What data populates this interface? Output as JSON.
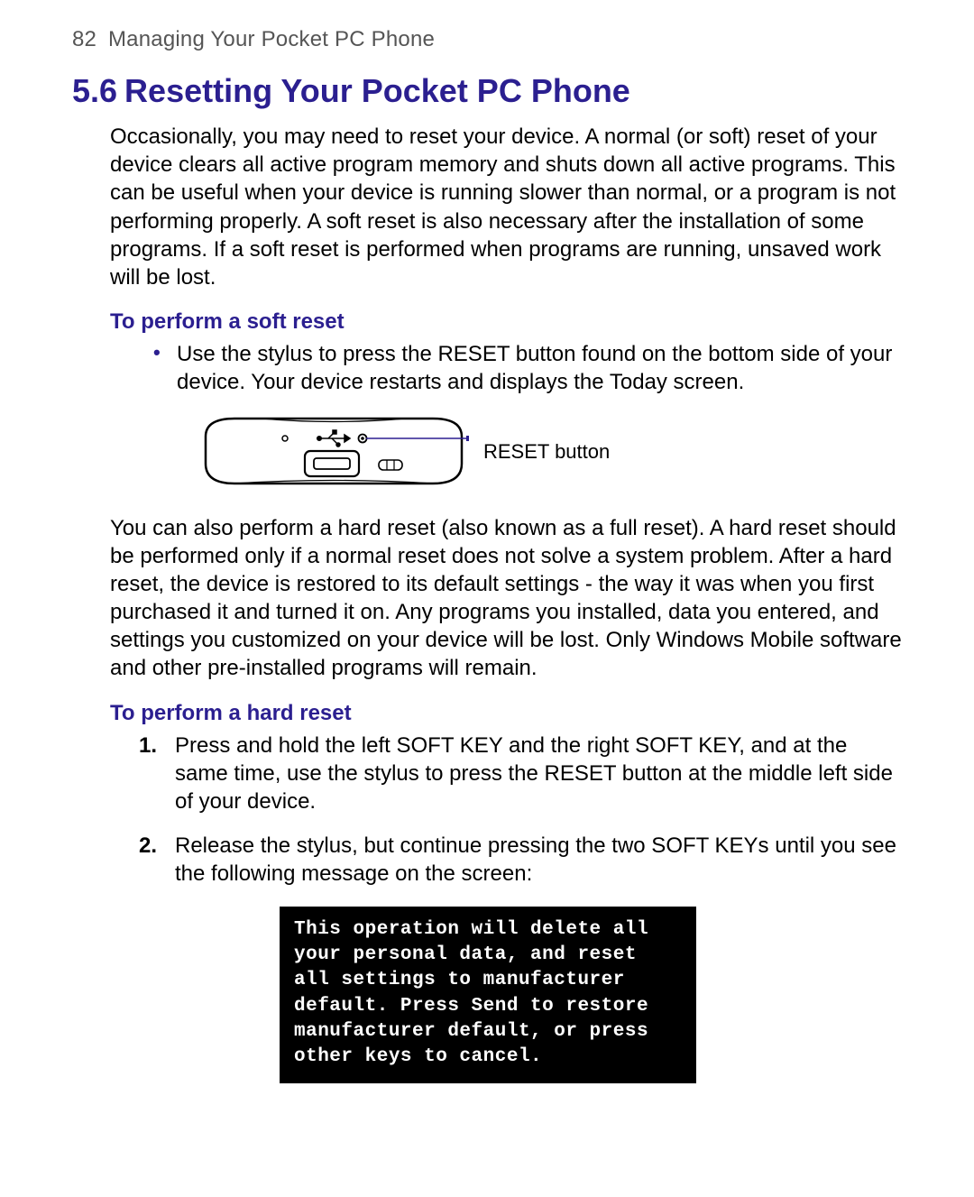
{
  "header": {
    "page_number": "82",
    "chapter_title": "Managing Your Pocket PC Phone"
  },
  "section": {
    "number": "5.6",
    "title": "Resetting Your Pocket PC Phone"
  },
  "intro_paragraph": "Occasionally, you may need to reset your device. A normal (or soft) reset of your device clears all active program memory and shuts down all active programs. This can be useful when your device is running slower than normal, or a program is not performing properly. A soft reset is also necessary after the installation of some programs. If a soft reset is performed when programs are running, unsaved work will be lost.",
  "soft_reset": {
    "heading": "To perform a soft reset",
    "bullet": "Use the stylus to press the RESET button found on the bottom side of your device. Your device restarts and displays the Today screen.",
    "callout_label": "RESET button"
  },
  "hard_reset_intro": "You can also perform a hard reset (also known as a full reset). A hard reset should be performed only if a normal reset does not solve a system problem. After a hard reset, the device is restored to its default settings - the way it was when you first purchased it and turned it on. Any programs you installed, data you entered, and settings you customized on your device will be lost. Only Windows Mobile software and other pre-installed programs will remain.",
  "hard_reset": {
    "heading": "To perform a hard reset",
    "steps": [
      "Press and hold the left SOFT KEY and the right SOFT KEY, and at the same time, use the stylus to press the RESET button at the middle left side of your device.",
      "Release the stylus, but continue pressing the two SOFT KEYs until you see the following message on the screen:"
    ],
    "console_message": "This operation will delete all your personal data, and reset all settings to manufacturer default. Press Send to restore manufacturer default, or press other keys to cancel."
  }
}
